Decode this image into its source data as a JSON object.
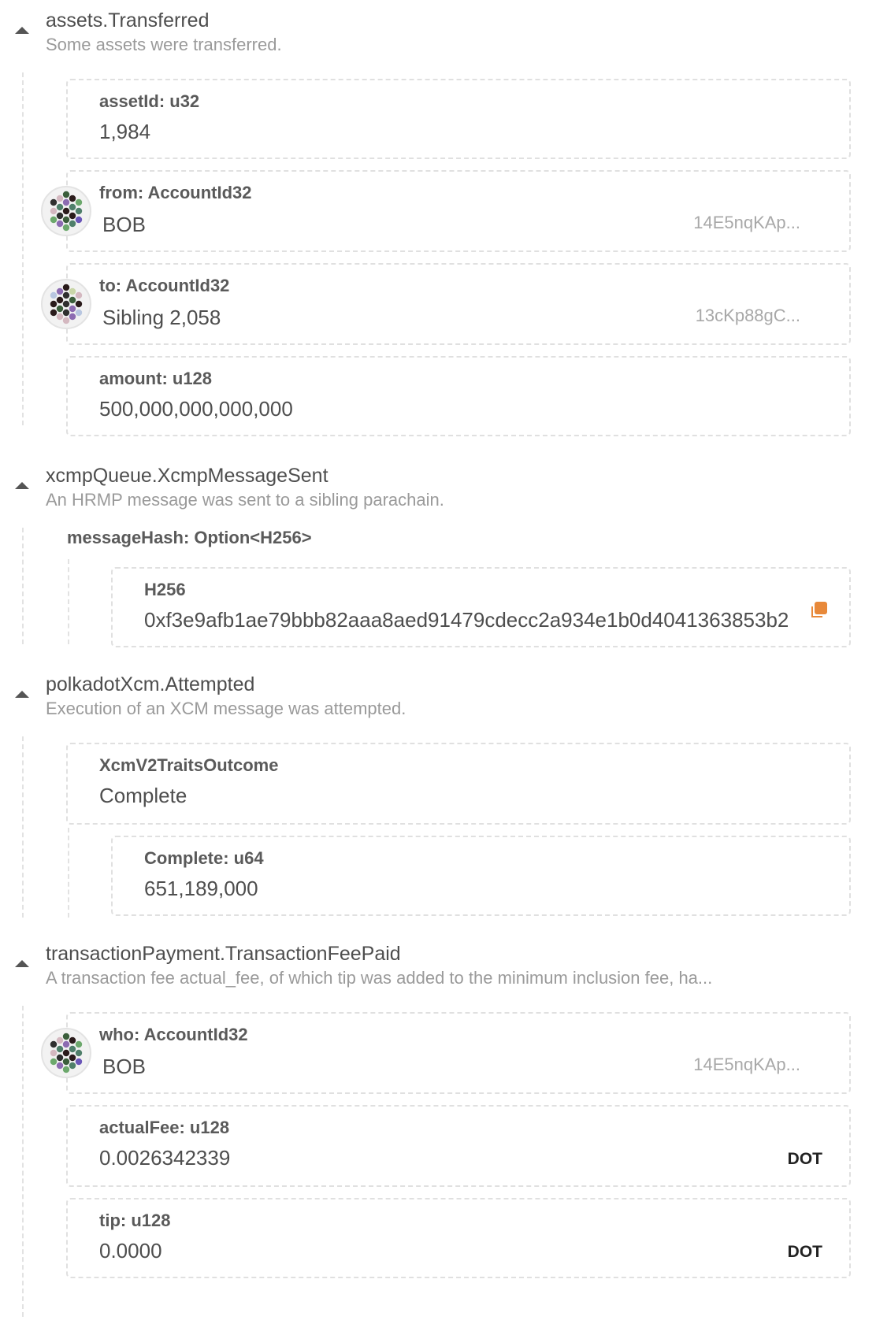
{
  "events": [
    {
      "name": "assets.Transferred",
      "description": "Some assets were transferred.",
      "params": [
        {
          "label": "assetId: u32",
          "value": "1,984"
        },
        {
          "label": "from: AccountId32",
          "value": "BOB",
          "address": "14E5nqKAp..."
        },
        {
          "label": "to: AccountId32",
          "value": "Sibling 2,058",
          "address": "13cKp88gC..."
        },
        {
          "label": "amount: u128",
          "value": "500,000,000,000,000"
        }
      ]
    },
    {
      "name": "xcmpQueue.XcmpMessageSent",
      "description": "An HRMP message was sent to a sibling parachain.",
      "params": [
        {
          "label": "messageHash: Option<H256>",
          "inner_label": "H256",
          "value": "0xf3e9afb1ae79bbb82aaa8aed91479cdecc2a934e1b0d4041363853b2"
        }
      ]
    },
    {
      "name": "polkadotXcm.Attempted",
      "description": "Execution of an XCM message was attempted.",
      "params": [
        {
          "label": "XcmV2TraitsOutcome",
          "value": "Complete"
        },
        {
          "label": "Complete: u64",
          "value": "651,189,000"
        }
      ]
    },
    {
      "name": "transactionPayment.TransactionFeePaid",
      "description": "A transaction fee actual_fee, of which tip was added to the minimum inclusion fee, ha...",
      "params": [
        {
          "label": "who: AccountId32",
          "value": "BOB",
          "address": "14E5nqKAp..."
        },
        {
          "label": "actualFee: u128",
          "value": "0.0026342339",
          "unit": "DOT"
        },
        {
          "label": "tip: u128",
          "value": "0.0000",
          "unit": "DOT"
        }
      ]
    }
  ],
  "icons": {
    "caret": "caret-up-icon",
    "copy": "copy-icon",
    "avatar": "identicon"
  },
  "colors": {
    "copy_icon": "#e8893a",
    "dashed_border": "#e0e0e0",
    "description": "#9a9a9a"
  }
}
